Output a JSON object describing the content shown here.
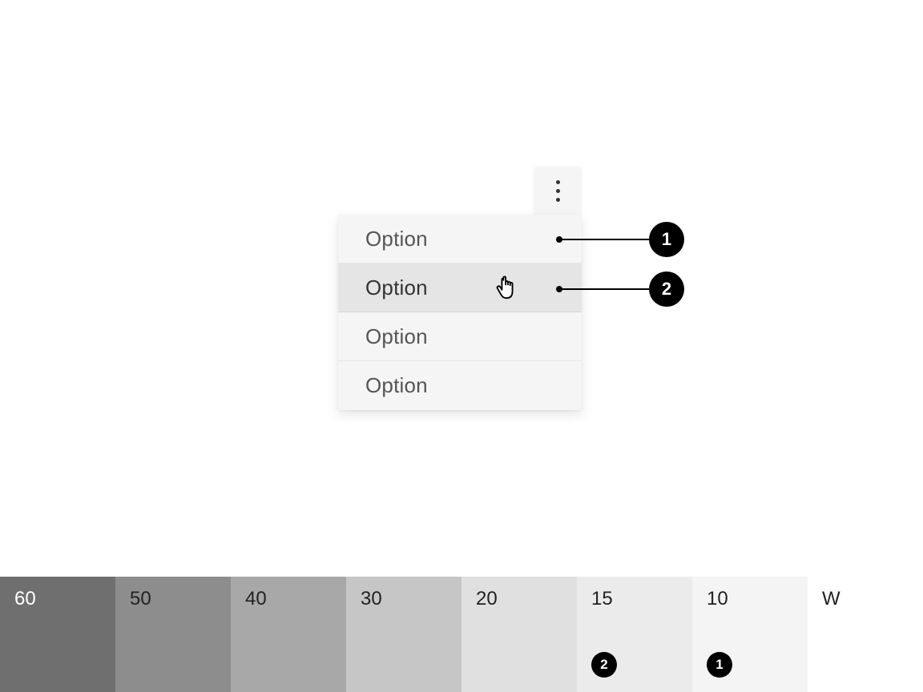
{
  "menu": {
    "items": [
      {
        "label": "Option",
        "hovered": false
      },
      {
        "label": "Option",
        "hovered": true
      },
      {
        "label": "Option",
        "hovered": false
      },
      {
        "label": "Option",
        "hovered": false
      }
    ]
  },
  "annotations": [
    {
      "badge": "1"
    },
    {
      "badge": "2"
    }
  ],
  "swatches": [
    {
      "label": "60",
      "hex": "#6f6f6f",
      "light_text": true
    },
    {
      "label": "50",
      "hex": "#8d8d8d"
    },
    {
      "label": "40",
      "hex": "#a8a8a8"
    },
    {
      "label": "30",
      "hex": "#c6c6c6"
    },
    {
      "label": "20",
      "hex": "#e0e0e0"
    },
    {
      "label": "15",
      "hex": "#ebebeb",
      "badge": "2"
    },
    {
      "label": "10",
      "hex": "#f4f4f4",
      "badge": "1"
    },
    {
      "label": "W",
      "hex": "#ffffff"
    }
  ]
}
